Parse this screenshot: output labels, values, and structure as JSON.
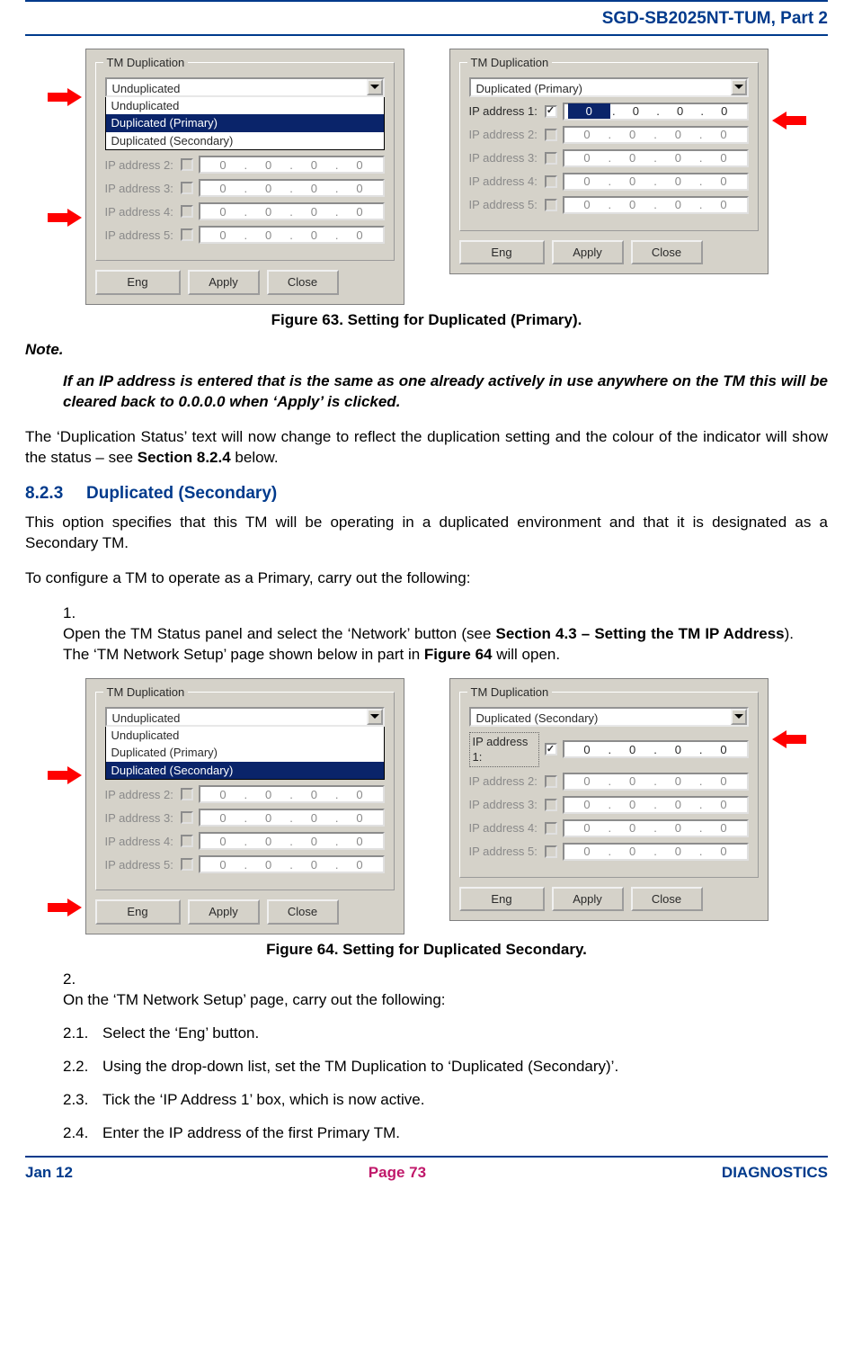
{
  "header": {
    "title": "SGD-SB2025NT-TUM, Part 2"
  },
  "figure63": {
    "caption": "Figure 63.  Setting for Duplicated (Primary).",
    "left": {
      "legend": "TM Duplication",
      "combo": "Unduplicated",
      "options": [
        "Unduplicated",
        "Duplicated (Primary)",
        "Duplicated (Secondary)"
      ],
      "selected": "Duplicated (Primary)",
      "rows": [
        {
          "label": "IP address 2:",
          "oct": [
            "0",
            "0",
            "0",
            "0"
          ]
        },
        {
          "label": "IP address 3:",
          "oct": [
            "0",
            "0",
            "0",
            "0"
          ]
        },
        {
          "label": "IP address 4:",
          "oct": [
            "0",
            "0",
            "0",
            "0"
          ]
        },
        {
          "label": "IP address 5:",
          "oct": [
            "0",
            "0",
            "0",
            "0"
          ]
        }
      ],
      "buttons": {
        "eng": "Eng",
        "apply": "Apply",
        "close": "Close"
      }
    },
    "right": {
      "legend": "TM Duplication",
      "combo": "Duplicated (Primary)",
      "rows": [
        {
          "label": "IP address 1:",
          "checked": true,
          "hl0": true,
          "oct": [
            "0",
            "0",
            "0",
            "0"
          ]
        },
        {
          "label": "IP address 2:",
          "oct": [
            "0",
            "0",
            "0",
            "0"
          ]
        },
        {
          "label": "IP address 3:",
          "oct": [
            "0",
            "0",
            "0",
            "0"
          ]
        },
        {
          "label": "IP address 4:",
          "oct": [
            "0",
            "0",
            "0",
            "0"
          ]
        },
        {
          "label": "IP address 5:",
          "oct": [
            "0",
            "0",
            "0",
            "0"
          ]
        }
      ],
      "buttons": {
        "eng": "Eng",
        "apply": "Apply",
        "close": "Close"
      }
    }
  },
  "noteHdr": "Note.",
  "noteBody": "If an IP address is entered that is the same as one already actively in use anywhere on the TM this will be cleared back to 0.0.0.0 when ‘Apply’ is clicked.",
  "para1a": "The ‘Duplication Status’ text will now change to reflect the duplication setting and the colour of the indicator will show the status – see ",
  "para1b": "Section 8.2.4",
  "para1c": " below.",
  "sec": {
    "num": "8.2.3",
    "title": "Duplicated (Secondary)"
  },
  "para2": "This option specifies that this TM will be operating in a duplicated environment and that it is designated as a Secondary TM.",
  "para3": "To configure a TM to operate as a Primary, carry out the following:",
  "step1": {
    "num": "1.",
    "a": "Open the TM Status panel and select the ‘Network’ button (see ",
    "b": "Section 4.3 – Setting the TM IP Address",
    "c": ").  The ‘TM Network Setup’ page shown below in part in ",
    "d": "Figure 64",
    "e": " will open."
  },
  "figure64": {
    "caption": "Figure 64.  Setting for Duplicated Secondary.",
    "left": {
      "legend": "TM Duplication",
      "combo": "Unduplicated",
      "options": [
        "Unduplicated",
        "Duplicated (Primary)",
        "Duplicated (Secondary)"
      ],
      "selected": "Duplicated (Secondary)",
      "rows": [
        {
          "label": "IP address 2:",
          "oct": [
            "0",
            "0",
            "0",
            "0"
          ]
        },
        {
          "label": "IP address 3:",
          "oct": [
            "0",
            "0",
            "0",
            "0"
          ]
        },
        {
          "label": "IP address 4:",
          "oct": [
            "0",
            "0",
            "0",
            "0"
          ]
        },
        {
          "label": "IP address 5:",
          "oct": [
            "0",
            "0",
            "0",
            "0"
          ]
        }
      ],
      "buttons": {
        "eng": "Eng",
        "apply": "Apply",
        "close": "Close"
      }
    },
    "right": {
      "legend": "TM Duplication",
      "combo": "Duplicated (Secondary)",
      "rows": [
        {
          "label": "IP address 1:",
          "dotted": true,
          "checked": true,
          "oct": [
            "0",
            "0",
            "0",
            "0"
          ]
        },
        {
          "label": "IP address 2:",
          "oct": [
            "0",
            "0",
            "0",
            "0"
          ]
        },
        {
          "label": "IP address 3:",
          "oct": [
            "0",
            "0",
            "0",
            "0"
          ]
        },
        {
          "label": "IP address 4:",
          "oct": [
            "0",
            "0",
            "0",
            "0"
          ]
        },
        {
          "label": "IP address 5:",
          "oct": [
            "0",
            "0",
            "0",
            "0"
          ]
        }
      ],
      "buttons": {
        "eng": "Eng",
        "apply": "Apply",
        "close": "Close"
      }
    }
  },
  "step2": {
    "num": "2.",
    "text": "On the ‘TM Network Setup’ page, carry out the following:"
  },
  "sub": [
    {
      "num": "2.1.",
      "text": "Select the ‘Eng’ button."
    },
    {
      "num": "2.2.",
      "text": "Using the drop-down list, set the TM Duplication to ‘Duplicated (Secondary)’."
    },
    {
      "num": "2.3.",
      "text": "Tick the ‘IP Address 1’ box, which is now active."
    },
    {
      "num": "2.4.",
      "text": "Enter the IP address of the first Primary TM."
    }
  ],
  "footer": {
    "date": "Jan 12",
    "page": "Page 73",
    "diag": "DIAGNOSTICS"
  }
}
